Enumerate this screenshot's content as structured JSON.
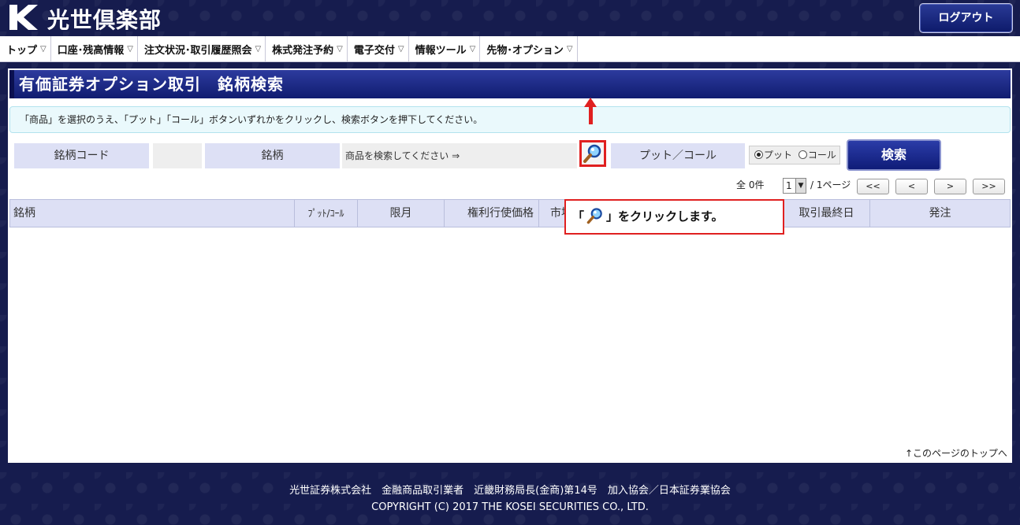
{
  "header": {
    "brand": "光世倶楽部",
    "logout_label": "ログアウト"
  },
  "nav": {
    "items": [
      {
        "label": "トップ"
      },
      {
        "label": "口座･残高情報"
      },
      {
        "label": "注文状況･取引履歴照会"
      },
      {
        "label": "株式発注予約"
      },
      {
        "label": "電子交付"
      },
      {
        "label": "情報ツール"
      },
      {
        "label": "先物･オプション"
      }
    ]
  },
  "page": {
    "title": "有価証券オプション取引　銘柄検索",
    "instruction": "「商品」を選択のうえ、「プット」「コール」ボタンいずれかをクリックし、検索ボタンを押下してください。"
  },
  "search_form": {
    "code_label": "銘柄コード",
    "name_label": "銘柄",
    "product_hint": "商品を検索してください ⇒",
    "putcall_label": "プット／コール",
    "put_label": "プット",
    "call_label": "コール",
    "selected": "put",
    "search_button": "検索"
  },
  "pager": {
    "total": "全 0件",
    "page_value": "1",
    "page_of": "/ 1ページ",
    "first": "<<",
    "prev": "<",
    "next": ">",
    "last": ">>"
  },
  "table": {
    "columns": [
      "銘柄",
      "ﾌﾟｯﾄ/ｺｰﾙ",
      "限月",
      "権利行使価格",
      "市場",
      "",
      "取引最終日",
      "発注"
    ]
  },
  "links": {
    "page_top": "↑このページのトップへ"
  },
  "callout": {
    "prefix": "「",
    "suffix": "」をクリックします。"
  },
  "footer": {
    "company": "光世証券株式会社　金融商品取引業者　近畿財務局長(金商)第14号　加入協会／日本証券業協会",
    "copyright": "COPYRIGHT (C) 2017 THE KOSEI SECURITIES CO., LTD."
  },
  "colors": {
    "background": "#161c4e",
    "title_bar": "#1a2888",
    "label_cell": "#dde0f5",
    "highlight": "#e02020"
  }
}
